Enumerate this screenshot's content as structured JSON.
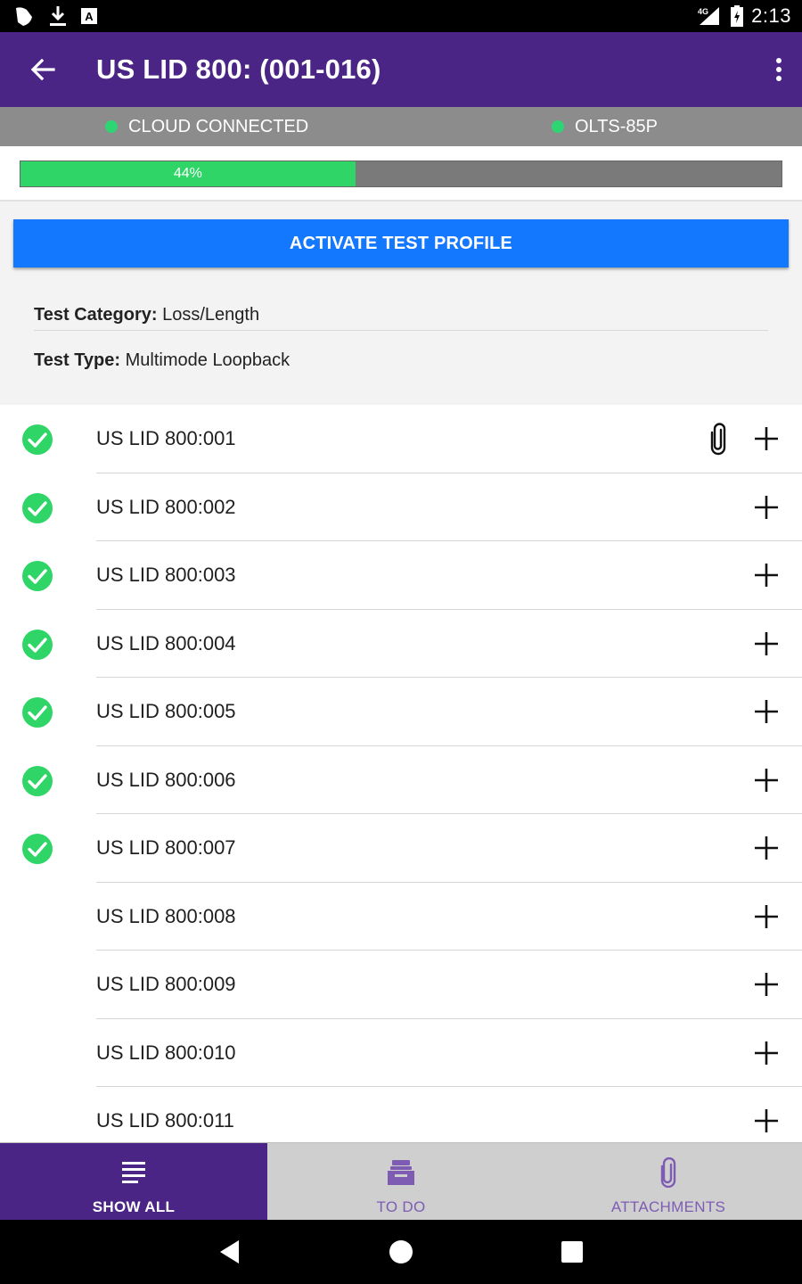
{
  "status_bar": {
    "time": "2:13",
    "network": "4G",
    "icons": [
      "app-notification-icon",
      "download-icon",
      "keyboard-a-icon",
      "signal-icon",
      "battery-charging-icon"
    ]
  },
  "app_bar": {
    "title": "US LID 800: (001-016)",
    "back_icon": "arrow-left-icon",
    "menu_icon": "more-vertical-icon"
  },
  "connection": {
    "cloud": "CLOUD CONNECTED",
    "device": "OLTS-85P",
    "status_color": "#2ed673"
  },
  "progress": {
    "value": 0.44,
    "label": "44%"
  },
  "profile": {
    "activate_label": "ACTIVATE TEST PROFILE",
    "category_label": "Test Category:",
    "category_value": "Loss/Length",
    "type_label": "Test Type:",
    "type_value": "Multimode Loopback"
  },
  "fibers": [
    {
      "label": "US LID 800:001",
      "done": true,
      "attachment": true
    },
    {
      "label": "US LID 800:002",
      "done": true,
      "attachment": false
    },
    {
      "label": "US LID 800:003",
      "done": true,
      "attachment": false
    },
    {
      "label": "US LID 800:004",
      "done": true,
      "attachment": false
    },
    {
      "label": "US LID 800:005",
      "done": true,
      "attachment": false
    },
    {
      "label": "US LID 800:006",
      "done": true,
      "attachment": false
    },
    {
      "label": "US LID 800:007",
      "done": true,
      "attachment": false
    },
    {
      "label": "US LID 800:008",
      "done": false,
      "attachment": false
    },
    {
      "label": "US LID 800:009",
      "done": false,
      "attachment": false
    },
    {
      "label": "US LID 800:010",
      "done": false,
      "attachment": false
    },
    {
      "label": "US LID 800:011",
      "done": false,
      "attachment": false
    }
  ],
  "tabs": [
    {
      "label": "SHOW ALL",
      "icon": "list-icon",
      "active": true
    },
    {
      "label": "TO DO",
      "icon": "inbox-icon",
      "active": false
    },
    {
      "label": "ATTACHMENTS",
      "icon": "paperclip-icon",
      "active": false
    }
  ],
  "colors": {
    "primary": "#4b2585",
    "accent_button": "#1478ff",
    "success": "#2fd566"
  }
}
